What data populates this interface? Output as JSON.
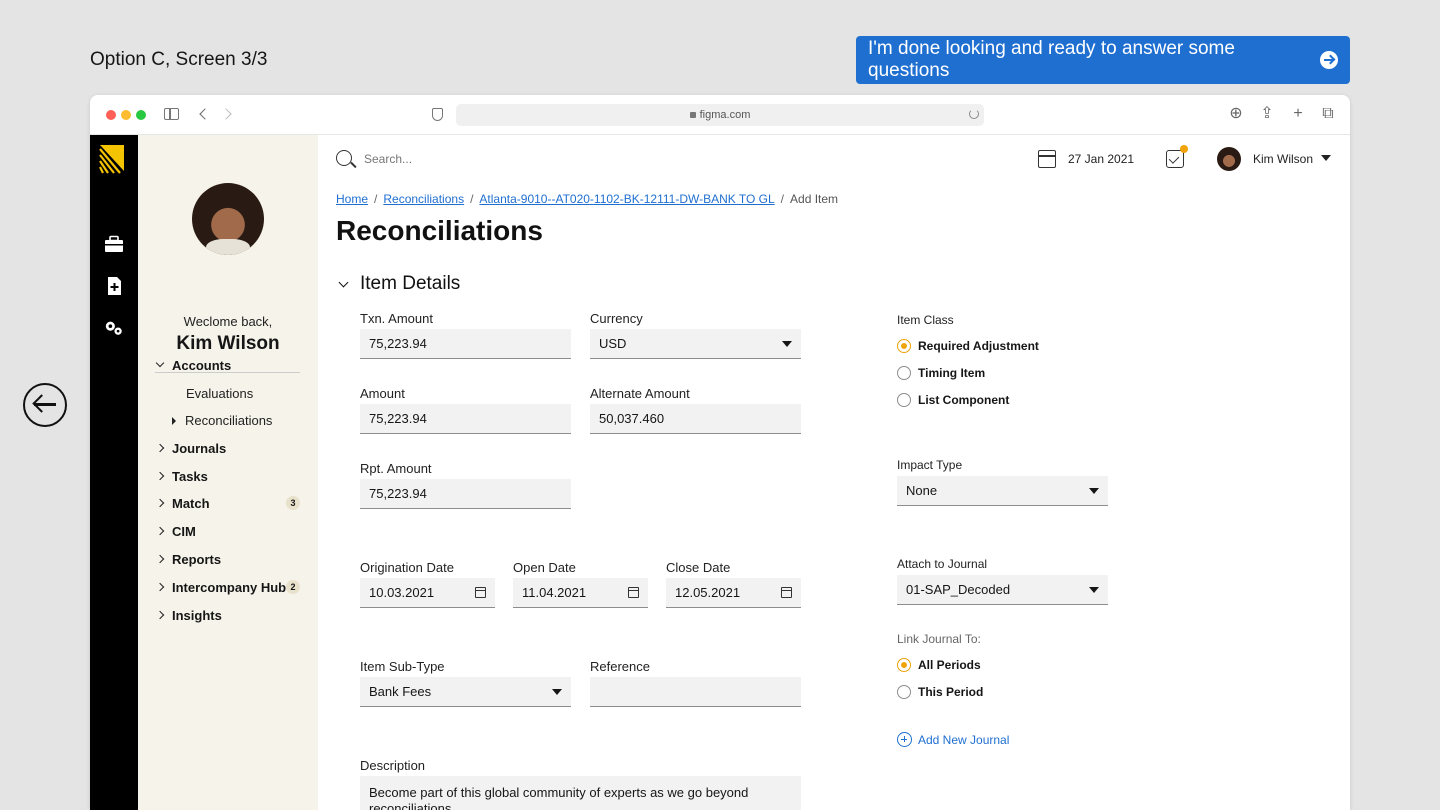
{
  "top": {
    "option_label": "Option C, Screen 3/3",
    "done_button": "I'm done looking and ready to answer some questions"
  },
  "browser": {
    "url": "figma.com"
  },
  "header": {
    "search_placeholder": "Search...",
    "date": "27 Jan 2021",
    "user_name": "Kim Wilson"
  },
  "sidebar": {
    "welcome": "Weclome back,",
    "name": "Kim Wilson",
    "items": [
      {
        "label": "Accounts",
        "expanded": true
      },
      {
        "label": "Journals"
      },
      {
        "label": "Tasks"
      },
      {
        "label": "Match",
        "badge": "3"
      },
      {
        "label": "CIM"
      },
      {
        "label": "Reports"
      },
      {
        "label": "Intercompany Hub",
        "badge": "2"
      },
      {
        "label": "Insights"
      }
    ],
    "subitems": {
      "evaluations": "Evaluations",
      "reconciliations": "Reconciliations"
    }
  },
  "breadcrumb": {
    "home": "Home",
    "reconciliations": "Reconciliations",
    "account": "Atlanta-9010--AT020-1102-BK-12111-DW-BANK TO GL",
    "current": "Add Item"
  },
  "page": {
    "title": "Reconciliations",
    "section": "Item Details"
  },
  "form": {
    "txn_amount": {
      "label": "Txn. Amount",
      "value": "75,223.94"
    },
    "currency": {
      "label": "Currency",
      "value": "USD"
    },
    "amount": {
      "label": "Amount",
      "value": "75,223.94"
    },
    "alternate_amount": {
      "label": "Alternate Amount",
      "value": "50,037.460"
    },
    "rpt_amount": {
      "label": "Rpt. Amount",
      "value": "75,223.94"
    },
    "origination_date": {
      "label": "Origination Date",
      "value": "10.03.2021"
    },
    "open_date": {
      "label": "Open Date",
      "value": "11.04.2021"
    },
    "close_date": {
      "label": "Close Date",
      "value": "12.05.2021"
    },
    "item_sub_type": {
      "label": "Item Sub-Type",
      "value": "Bank Fees"
    },
    "reference": {
      "label": "Reference",
      "value": ""
    },
    "description": {
      "label": "Description",
      "value": "Become part of this global community of experts as we go beyond reconciliations"
    }
  },
  "right": {
    "item_class": {
      "label": "Item Class",
      "options": [
        "Required Adjustment",
        "Timing Item",
        "List Component"
      ],
      "selected": "Required Adjustment"
    },
    "impact_type": {
      "label": "Impact Type",
      "value": "None"
    },
    "attach_journal": {
      "label": "Attach to Journal",
      "value": "01-SAP_Decoded"
    },
    "link_journal": {
      "label": "Link Journal To:",
      "options": [
        "All Periods",
        "This Period"
      ],
      "selected": "All Periods"
    },
    "add_journal": "Add New Journal"
  },
  "colors": {
    "accent": "#f0a30a",
    "link": "#1f6fd1",
    "rail": "#000000",
    "sidebar_bg": "#f6f3ea"
  }
}
